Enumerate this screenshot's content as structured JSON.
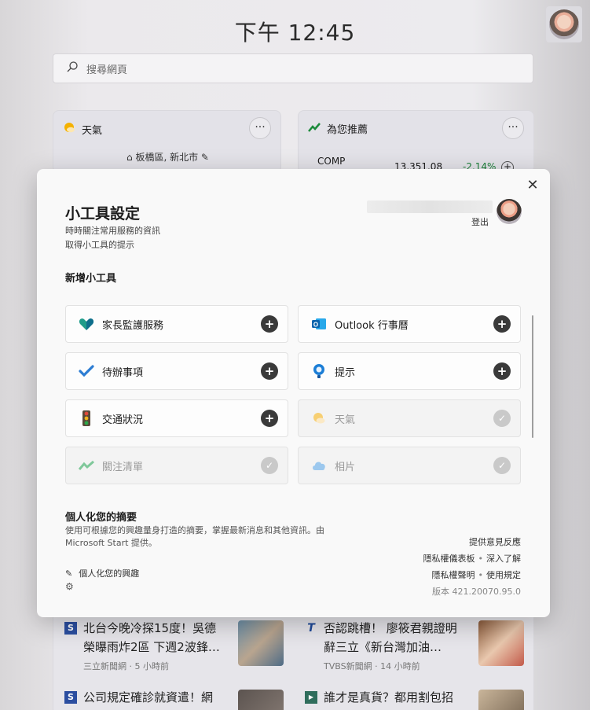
{
  "time": "下午 12:45",
  "search": {
    "placeholder": "搜尋網頁"
  },
  "weather_card": {
    "title": "天氣",
    "location": "板橋區, 新北市"
  },
  "stock_card": {
    "title": "為您推薦",
    "symbol": "COMP",
    "value": "13,351.08",
    "change": "-2.14%"
  },
  "news": [
    {
      "title": "北台今晚冷探15度！吳德榮曝雨炸2區 下週2波鋒…",
      "source": "三立新聞網 · 5 小時前",
      "source_icon": "S",
      "icon_color": "#2b4ea0"
    },
    {
      "title": "否認跳槽！ 廖筱君親證明辭三立《新台灣加油…",
      "source": "TVBS新聞網 · 14 小時前",
      "source_icon": "T",
      "icon_color": "#1f4a9a"
    },
    {
      "title": "公司規定確診就資遣！網",
      "source": "",
      "source_icon": "S",
      "icon_color": "#2b4ea0"
    },
    {
      "title": "誰才是真貨？都用割包招",
      "source": "",
      "source_icon": "▶",
      "icon_color": "#2f6d5c"
    }
  ],
  "modal": {
    "title": "小工具設定",
    "subtitle1": "時時關注常用服務的資訊",
    "subtitle2": "取得小工具的提示",
    "signout": "登出",
    "add_label": "新增小工具",
    "widgets": [
      {
        "label": "家長監護服務",
        "icon": "family-heart-icon",
        "state": "add"
      },
      {
        "label": "Outlook 行事曆",
        "icon": "outlook-calendar-icon",
        "state": "add"
      },
      {
        "label": "待辦事項",
        "icon": "todo-check-icon",
        "state": "add"
      },
      {
        "label": "提示",
        "icon": "tips-bulb-icon",
        "state": "add"
      },
      {
        "label": "交通狀況",
        "icon": "traffic-light-icon",
        "state": "add"
      },
      {
        "label": "天氣",
        "icon": "weather-sun-icon",
        "state": "added"
      },
      {
        "label": "關注清單",
        "icon": "watchlist-chart-icon",
        "state": "added"
      },
      {
        "label": "相片",
        "icon": "photos-cloud-icon",
        "state": "added"
      }
    ],
    "personalize": {
      "title": "個人化您的摘要",
      "desc": "使用可根據您的興趣量身打造的摘要，掌握最新消息和其他資訊。由 Microsoft Start 提供。",
      "link": "個人化您的興趣"
    },
    "links": {
      "feedback": "提供意見反應",
      "privacy_dashboard": "隱私權儀表板",
      "learn_more": "深入了解",
      "privacy_statement": "隱私權聲明",
      "terms": "使用規定",
      "version": "版本 421.20070.95.0"
    }
  }
}
